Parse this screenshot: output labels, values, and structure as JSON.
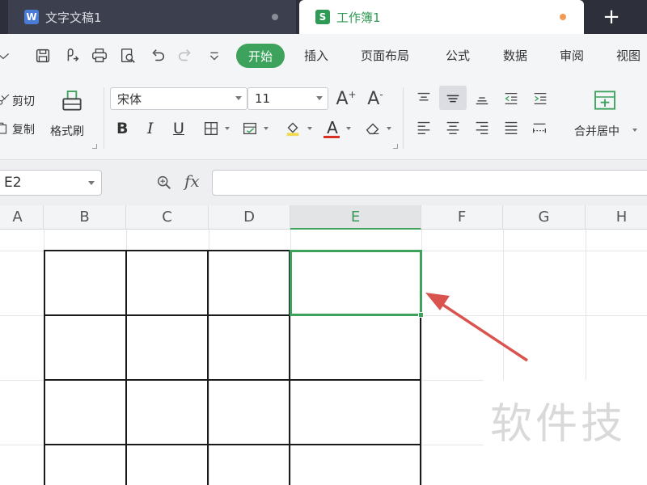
{
  "tabs": [
    {
      "label": "文字文稿1",
      "icon": "W",
      "active": false
    },
    {
      "label": "工作簿1",
      "icon": "S",
      "active": true
    }
  ],
  "tab_add": "+",
  "menu": {
    "active": "开始",
    "items": [
      "插入",
      "页面布局",
      "公式",
      "数据",
      "审阅",
      "视图"
    ]
  },
  "ribbon": {
    "cut": "剪切",
    "copy": "复制",
    "format_painter": "格式刷",
    "font_name": "宋体",
    "font_size": "11",
    "grow_font": "A",
    "shrink_font": "A",
    "bold": "B",
    "italic": "I",
    "underline": "U",
    "font_color_letter": "A",
    "merge_center": "合并居中"
  },
  "formula_bar": {
    "name_box": "E2",
    "fx": "fx",
    "formula": ""
  },
  "grid": {
    "columns": [
      "A",
      "B",
      "C",
      "D",
      "E",
      "F",
      "G",
      "H"
    ],
    "active_column": "E",
    "selected_cell": "E2"
  },
  "watermark": "软件技",
  "colors": {
    "accent": "#3ca25c",
    "tabbar": "#2d2f3a",
    "annotation_arrow": "#d9534f"
  }
}
